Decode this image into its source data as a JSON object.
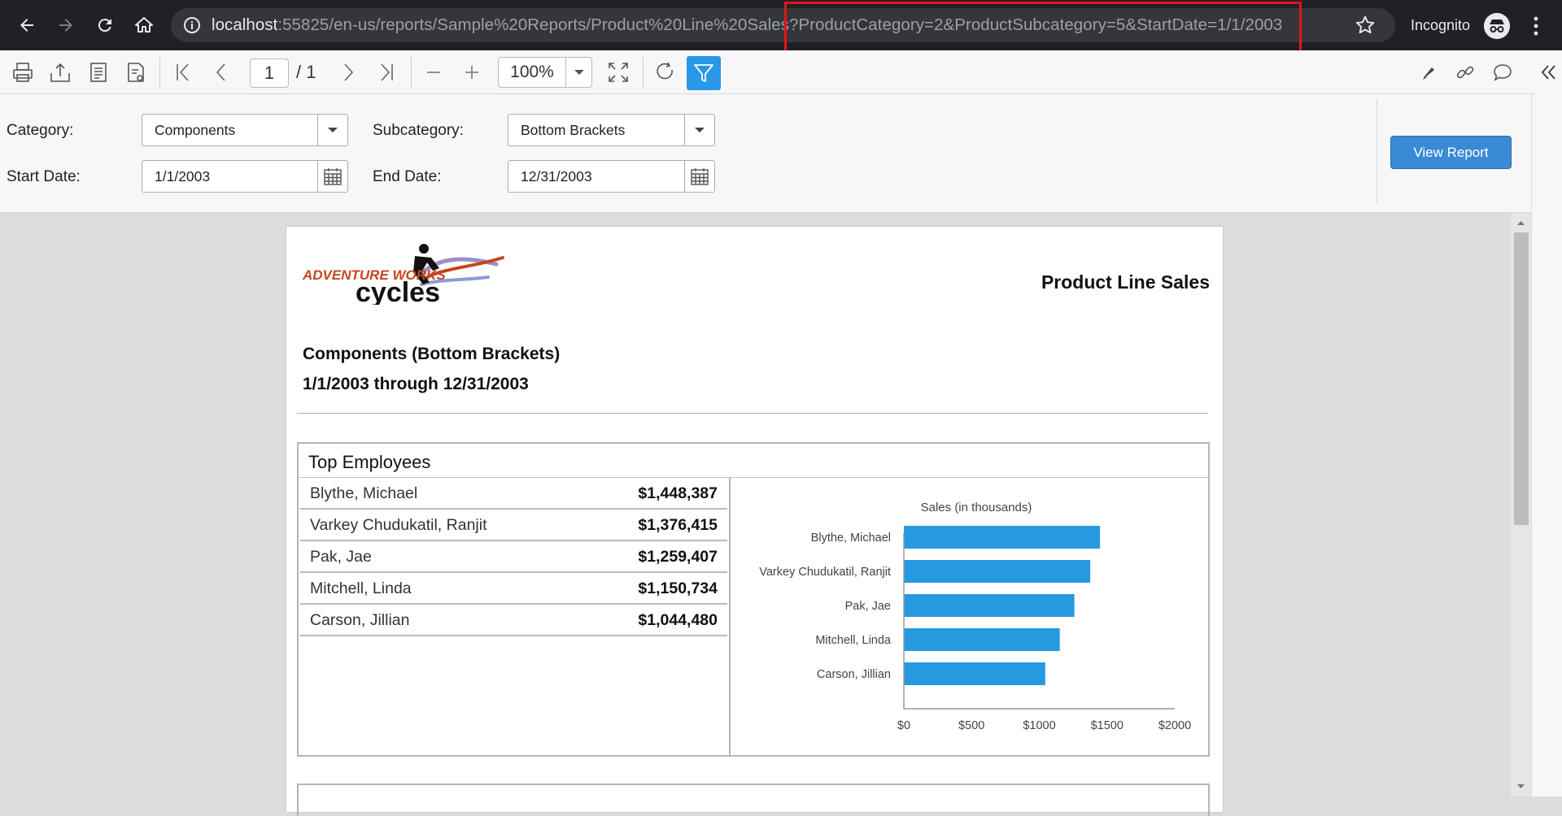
{
  "browser": {
    "url_host": "localhost",
    "url_rest": ":55825/en-us/reports/Sample%20Reports/Product%20Line%20Sales?ProductCategory=2&ProductSubcategory=5&StartDate=1/1/2003",
    "incognito_label": "Incognito"
  },
  "toolbar": {
    "page_current": "1",
    "page_total": "/ 1",
    "zoom": "100%"
  },
  "params": {
    "category_label": "Category:",
    "category_value": "Components",
    "subcategory_label": "Subcategory:",
    "subcategory_value": "Bottom Brackets",
    "start_label": "Start Date:",
    "start_value": "1/1/2003",
    "end_label": "End Date:",
    "end_value": "12/31/2003",
    "view_report": "View Report"
  },
  "report": {
    "logo_text_small": "ADVENTURE WORKS",
    "logo_text_big": "cycles",
    "title": "Product Line Sales",
    "subtitle1": "Components (Bottom Brackets)",
    "subtitle2": "1/1/2003 through 12/31/2003",
    "top_employees": {
      "title": "Top Employees",
      "rows": [
        {
          "name": "Blythe, Michael",
          "value": "$1,448,387"
        },
        {
          "name": "Varkey Chudukatil, Ranjit",
          "value": "$1,376,415"
        },
        {
          "name": "Pak, Jae",
          "value": "$1,259,407"
        },
        {
          "name": "Mitchell, Linda",
          "value": "$1,150,734"
        },
        {
          "name": "Carson, Jillian",
          "value": "$1,044,480"
        }
      ]
    }
  },
  "chart_data": {
    "type": "bar",
    "orientation": "horizontal",
    "title": "Sales (in thousands)",
    "categories": [
      "Blythe, Michael",
      "Varkey Chudukatil, Ranjit",
      "Pak, Jae",
      "Mitchell, Linda",
      "Carson, Jillian"
    ],
    "values": [
      1448,
      1376,
      1259,
      1151,
      1044
    ],
    "xlim": [
      0,
      2000
    ],
    "ticks": [
      0,
      500,
      1000,
      1500,
      2000
    ],
    "tick_labels": [
      "$0",
      "$500",
      "$1000",
      "$1500",
      "$2000"
    ],
    "color": "#2699e0",
    "grid": false
  }
}
